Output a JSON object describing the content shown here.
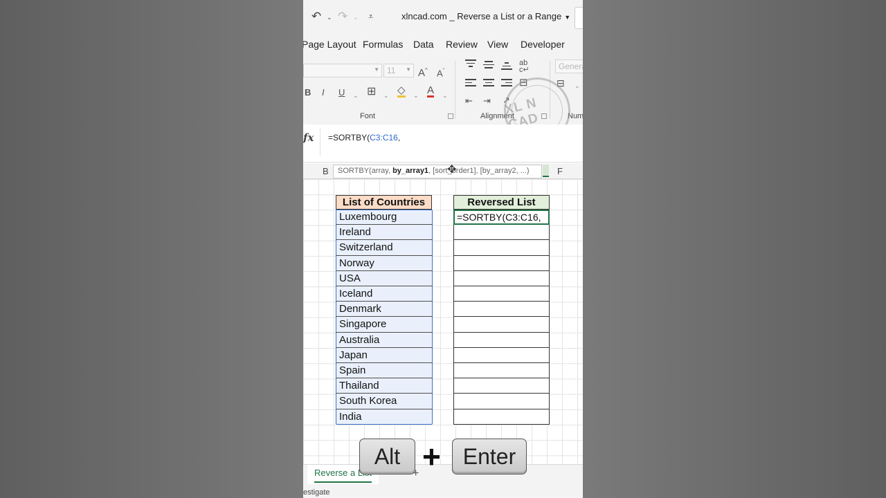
{
  "window": {
    "title": "xlncad.com _ Reverse a List or a Range"
  },
  "ribbon": {
    "tabs": [
      "Page Layout",
      "Formulas",
      "Data",
      "Review",
      "View",
      "Developer"
    ],
    "font_size": "11",
    "number_format": "Genera",
    "bold": "B",
    "italic": "I",
    "underline": "U",
    "group_font": "Font",
    "group_alignment": "Alignment",
    "group_number": "Num",
    "watermark": "XL N CAD"
  },
  "formula_bar": {
    "fx": "fx",
    "prefix": "=SORTBY(",
    "ref": "C3:C16",
    "suffix": ","
  },
  "columns": [
    "B",
    "F"
  ],
  "tooltip": {
    "pre": "SORTBY(array, ",
    "bold": "by_array1",
    "post": ", [sort_order1], [by_array2, ...)"
  },
  "sheet": {
    "countries_header": "List of Countries",
    "reversed_header": "Reversed List",
    "active_cell_text": "=SORTBY(C3:C16,",
    "countries": [
      "Luxembourg",
      "Ireland",
      "Switzerland",
      "Norway",
      "USA",
      "Iceland",
      "Denmark",
      "Singapore",
      "Australia",
      "Japan",
      "Spain",
      "Thailand",
      "South Korea",
      "India"
    ]
  },
  "keys": {
    "alt": "Alt",
    "plus": "+",
    "enter": "Enter"
  },
  "sheet_tabs": {
    "active": "Reverse a List",
    "add": "+"
  },
  "status": {
    "text": "estigate"
  },
  "colors": {
    "excel_green": "#217346",
    "reference_blue": "#2e66c8",
    "header_orange": "#fcdcc7",
    "header_green": "#e2efda"
  }
}
